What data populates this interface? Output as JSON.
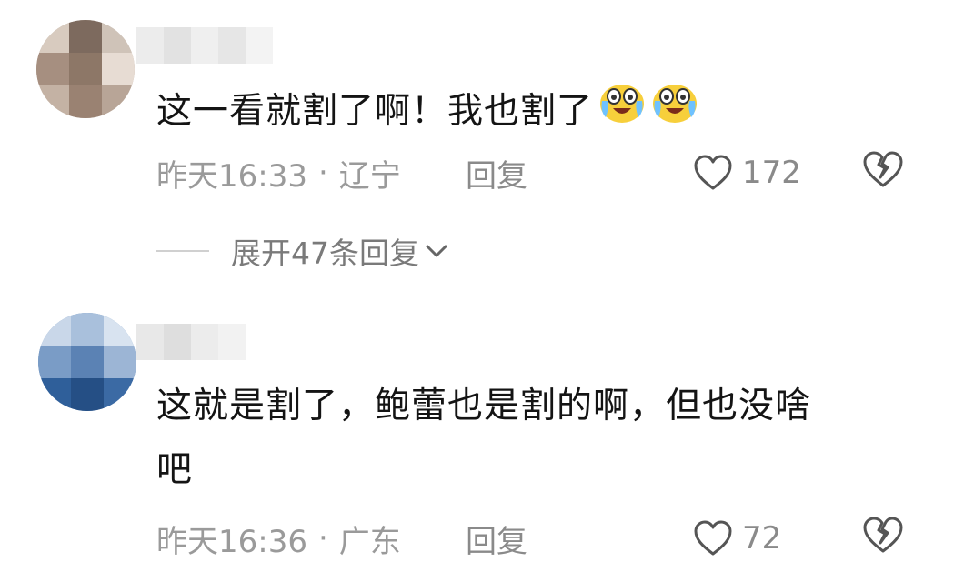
{
  "comments": [
    {
      "text": "这一看就割了啊！我也割了",
      "emojis": [
        "laugh-cry-emoji",
        "laugh-cry-emoji"
      ],
      "time": "昨天16:33",
      "separator": "·",
      "location": "辽宁",
      "reply_label": "回复",
      "likes": "172",
      "expand_label": "展开47条回复"
    },
    {
      "text_line1": "这就是割了，鲍蕾也是割的啊，但也没啥",
      "text_line2": "吧",
      "time": "昨天16:36",
      "separator": "·",
      "location": "广东",
      "reply_label": "回复",
      "likes": "72"
    }
  ],
  "icons": {
    "like": "heart-outline-icon",
    "dislike": "broken-heart-icon",
    "expand": "chevron-down-icon"
  },
  "colors": {
    "text": "#141414",
    "meta": "#9a9a9a",
    "background": "#ffffff"
  }
}
